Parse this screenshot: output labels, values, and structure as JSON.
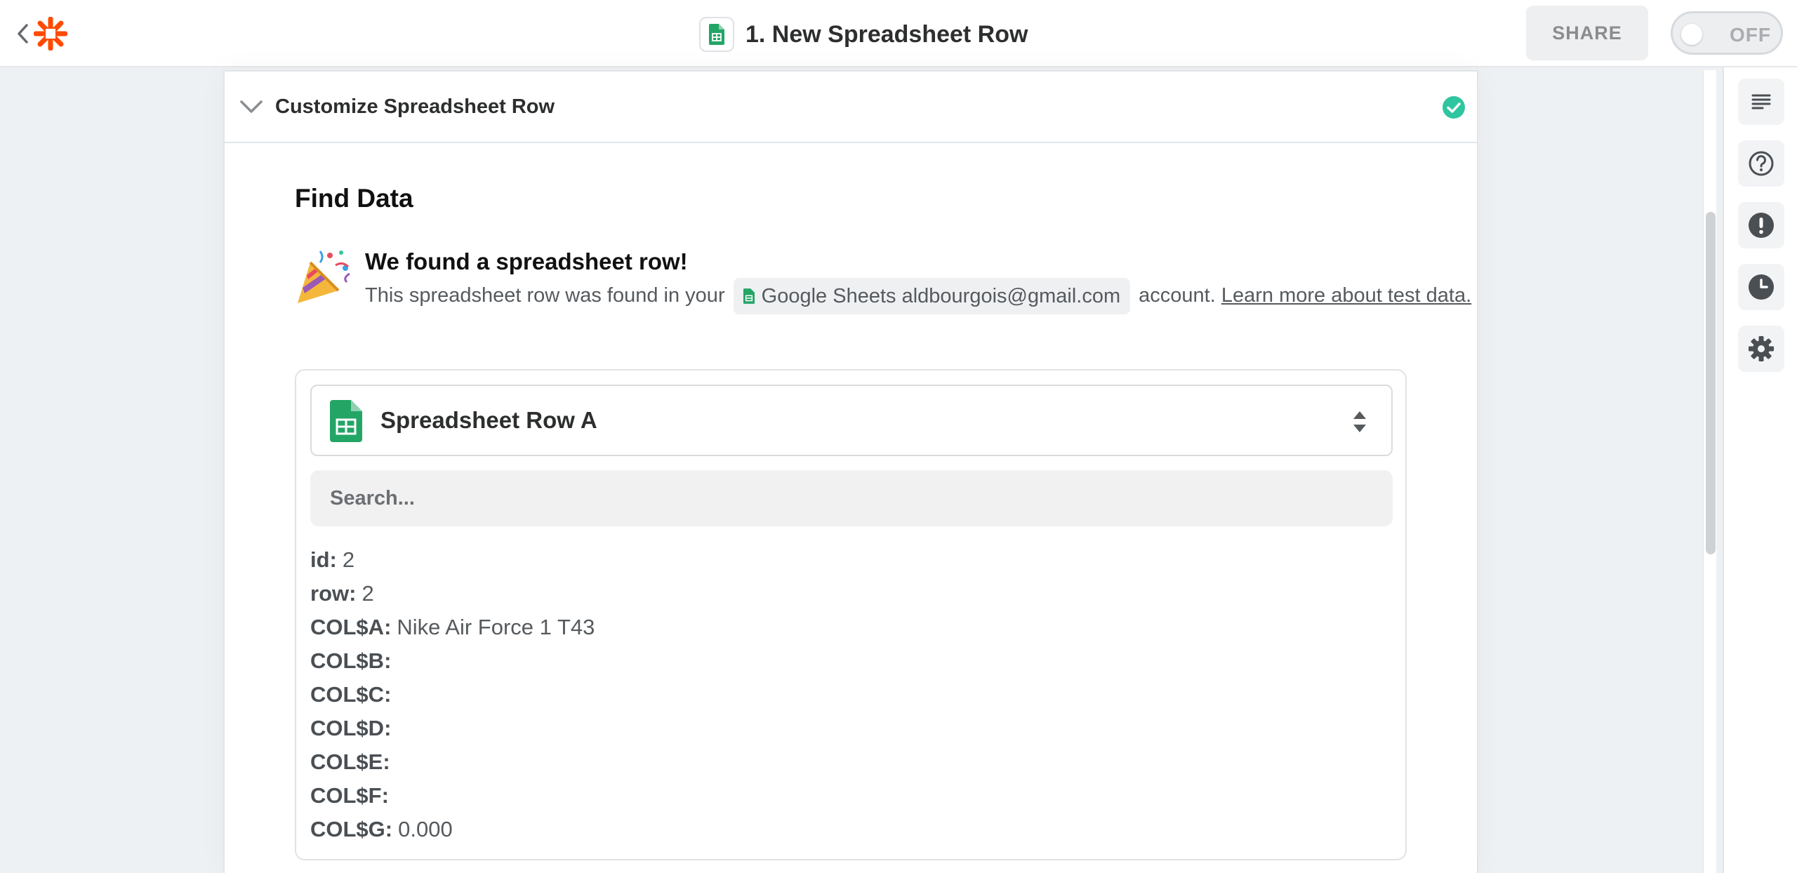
{
  "header": {
    "title": "1. New Spreadsheet Row",
    "share_label": "SHARE",
    "toggle_label": "OFF"
  },
  "section": {
    "title": "Customize Spreadsheet Row"
  },
  "find_data": {
    "title": "Find Data",
    "found_title": "We found a spreadsheet row!",
    "desc_prefix": "This spreadsheet row was found in your",
    "account_label": "Google Sheets aldbourgois@gmail.com",
    "desc_suffix": "account.",
    "learn_link": "Learn more about test data."
  },
  "record_select": {
    "selected": "Spreadsheet Row A"
  },
  "search": {
    "placeholder": "Search..."
  },
  "fields": [
    {
      "key": "id:",
      "value": "2"
    },
    {
      "key": "row:",
      "value": "2"
    },
    {
      "key": "COL$A:",
      "value": "Nike Air Force 1 T43"
    },
    {
      "key": "COL$B:",
      "value": ""
    },
    {
      "key": "COL$C:",
      "value": ""
    },
    {
      "key": "COL$D:",
      "value": ""
    },
    {
      "key": "COL$E:",
      "value": ""
    },
    {
      "key": "COL$F:",
      "value": ""
    },
    {
      "key": "COL$G:",
      "value": "0.000"
    }
  ],
  "icons": {
    "logo": "zapier-asterisk-icon",
    "app": "google-sheets-icon",
    "rail": [
      "details-icon",
      "help-icon",
      "alert-icon",
      "history-icon",
      "settings-icon"
    ]
  },
  "colors": {
    "brand": "#ff4a00",
    "sheets_green": "#23a566",
    "success": "#2fc5a0"
  }
}
